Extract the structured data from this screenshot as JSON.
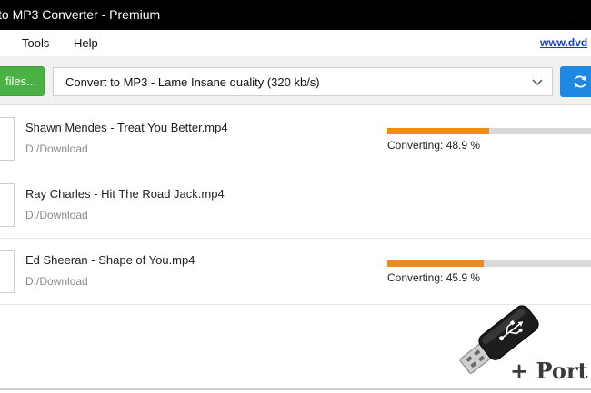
{
  "window": {
    "title": "to MP3 Converter - Premium"
  },
  "menu": {
    "items": [
      {
        "id": "tools",
        "label": "Tools"
      },
      {
        "id": "help",
        "label": "Help"
      }
    ],
    "site_link": "www.dvd"
  },
  "toolbar": {
    "add_button_label": "files...",
    "profile_value": "Convert to MP3 - Lame Insane quality (320 kb/s)"
  },
  "files": [
    {
      "name": "Shawn Mendes - Treat You Better.mp4",
      "path": "D:/Download",
      "progress": 0.489,
      "status": "Converting: 48.9 %"
    },
    {
      "name": "Ray Charles - Hit The Road Jack.mp4",
      "path": "D:/Download",
      "progress": null,
      "status": ""
    },
    {
      "name": "Ed Sheeran - Shape of You.mp4",
      "path": "D:/Download",
      "progress": 0.459,
      "status": "Converting: 45.9 %"
    }
  ],
  "watermark": {
    "label": "+ Port",
    "icon": "usb-flash-drive-icon"
  },
  "colors": {
    "title_bar": "#000000",
    "add_button": "#4ab245",
    "convert_button": "#1e88e5",
    "progress_fill": "#f08a1d",
    "progress_track": "#d9d9d9"
  }
}
